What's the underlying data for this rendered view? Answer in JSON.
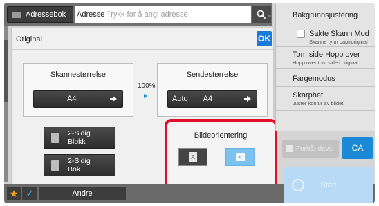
{
  "topbar": {
    "addressbook_label": "Adressebok",
    "address_label": "Adresse",
    "address_placeholder": "Trykk for å angi adresse",
    "search_icon": "magnifier-icon"
  },
  "dialog": {
    "title": "Original",
    "ok_label": "OK",
    "scan_size": {
      "title": "Skannestørrelse",
      "value": "A4"
    },
    "ratio": "100%",
    "send_size": {
      "title": "Sendestørrelse",
      "mode": "Auto",
      "value": "A4"
    },
    "duplex_booklet": "2-Sidig\nBlokk",
    "duplex_book": "2-Sidig\nBok",
    "orientation": {
      "title": "Bildeorientering",
      "options": [
        {
          "glyph": "A",
          "selected": false
        },
        {
          "glyph": "<",
          "selected": true
        }
      ]
    }
  },
  "bottombar": {
    "other_label": "Andre",
    "star_icon": "star-icon",
    "check_icon": "check-icon"
  },
  "rightpanel": {
    "items": [
      {
        "label": "Bakgrunnsjustering",
        "sub": ""
      },
      {
        "label": "Sakte Skann Mod",
        "sub": "Skanne tynn papiroriginal",
        "checkbox": true
      },
      {
        "label": "Tom side Hopp over",
        "sub": "Hopp over tom side i original"
      },
      {
        "label": "Fargemodus",
        "sub": ""
      },
      {
        "label": "Skarphet",
        "sub": "Juster kontur av bildet"
      }
    ]
  },
  "actions": {
    "preview_label": "Forhåndsvis",
    "ca_label": "CA",
    "start_label": "Start"
  },
  "colors": {
    "accent": "#1a7ad6",
    "highlight": "#e0102a",
    "selected": "#7cc2ee"
  }
}
